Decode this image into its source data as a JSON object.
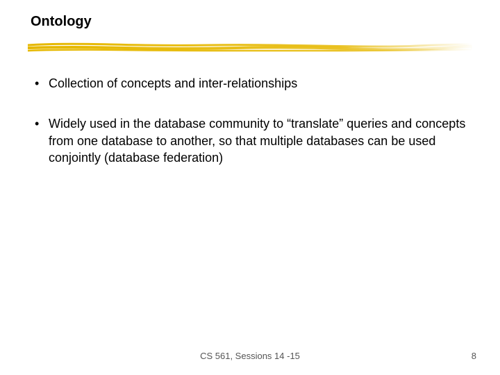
{
  "title": "Ontology",
  "bullets": [
    "Collection of concepts and inter-relationships",
    "Widely used in the database community to “translate” queries and concepts from one database to another, so that multiple databases can be used conjointly (database federation)"
  ],
  "footer": "CS 561,  Sessions 14 -15",
  "page_number": "8",
  "accent_color": "#e6b800"
}
